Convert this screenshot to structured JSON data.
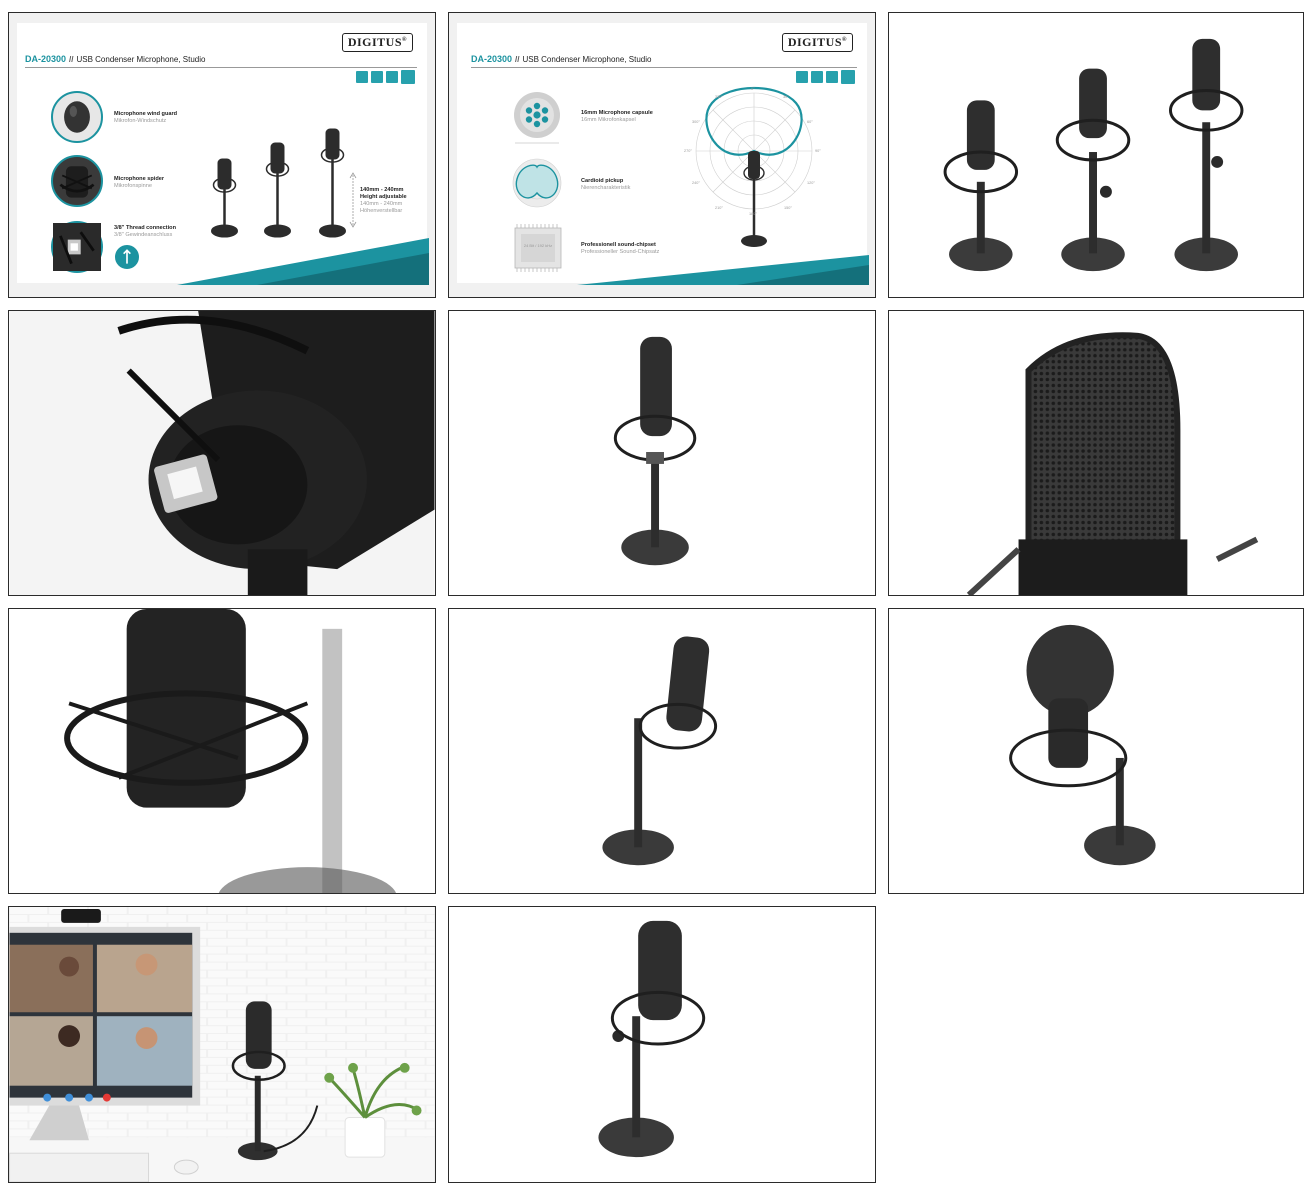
{
  "slide1": {
    "brand": "DIGITUS",
    "brand_mark": "®",
    "product_code": "DA-20300",
    "separator": "//",
    "product_name": "USB Condenser Microphone, Studio",
    "features": [
      {
        "title": "Microphone wind guard",
        "subtitle": "Mikrofon-Windschutz"
      },
      {
        "title": "Microphone spider",
        "subtitle": "Mikrofonspinne"
      },
      {
        "title": "3/8\" Thread connection",
        "subtitle": "3/8\" Gewindeanschluss"
      }
    ],
    "height": {
      "range": "140mm - 240mm",
      "title": "Height adjustable",
      "range_de": "140mm - 240mm",
      "subtitle": "Höhenverstellbar"
    }
  },
  "slide2": {
    "brand": "DIGITUS",
    "brand_mark": "®",
    "product_code": "DA-20300",
    "separator": "//",
    "product_name": "USB Condenser Microphone, Studio",
    "features": [
      {
        "title": "16mm Microphone capsule",
        "subtitle": "16mm Mikrofonkapsel"
      },
      {
        "title": "Cardioid pickup",
        "subtitle": "Nierencharakteristik"
      },
      {
        "title": "Professionell sound-chipset",
        "subtitle": "Professioneller Sound-Chipsatz"
      }
    ],
    "chip_label": "24 Bit / 192 kHz",
    "polar_angles": [
      "0°",
      "30°",
      "60°",
      "90°",
      "120°",
      "150°",
      "180°",
      "210°",
      "240°",
      "270°",
      "300°",
      "330°"
    ]
  },
  "colors": {
    "accent": "#1c93a0",
    "accent_dark": "#14707b",
    "mic_body": "#2c2c2c",
    "mic_grille": "#3d3d3d"
  },
  "icons": [
    "usb-icon",
    "plug-and-play-icon",
    "driver-free-icon",
    "arrow-right-icon"
  ]
}
